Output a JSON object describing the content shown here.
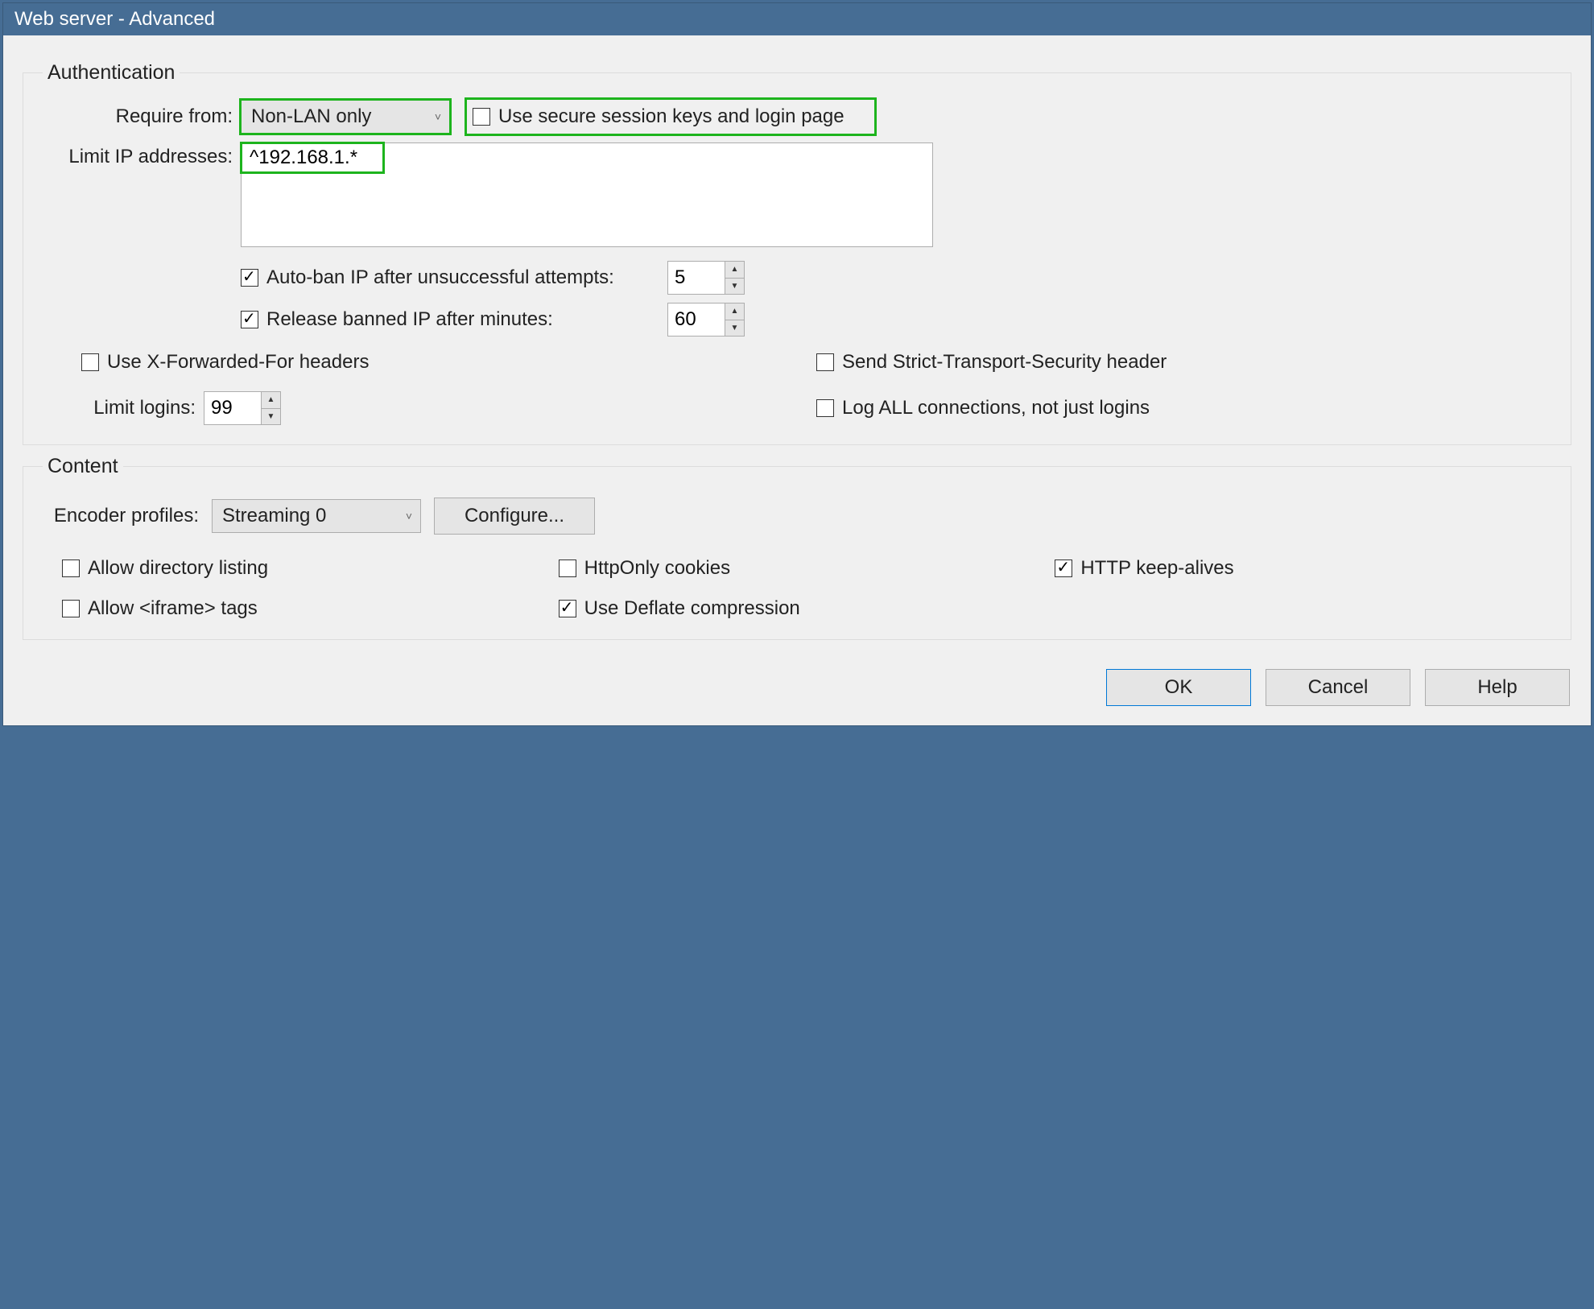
{
  "window": {
    "title": "Web server - Advanced"
  },
  "auth": {
    "legend": "Authentication",
    "require_from_label": "Require from:",
    "require_from_value": "Non-LAN only",
    "secure_session_label": "Use secure session keys and login page",
    "secure_session_checked": false,
    "limit_ip_label": "Limit IP addresses:",
    "limit_ip_value": "^192.168.1.*",
    "autoban_label": "Auto-ban IP after unsuccessful attempts:",
    "autoban_checked": true,
    "autoban_value": "5",
    "release_label": "Release banned IP after minutes:",
    "release_checked": true,
    "release_value": "60",
    "xff_label": "Use X-Forwarded-For headers",
    "xff_checked": false,
    "hsts_label": "Send Strict-Transport-Security header",
    "hsts_checked": false,
    "limit_logins_label": "Limit logins:",
    "limit_logins_value": "99",
    "logall_label": "Log ALL connections, not just logins",
    "logall_checked": false
  },
  "content": {
    "legend": "Content",
    "encoder_label": "Encoder profiles:",
    "encoder_value": "Streaming 0",
    "configure_label": "Configure...",
    "dirlist_label": "Allow directory listing",
    "dirlist_checked": false,
    "httponly_label": "HttpOnly cookies",
    "httponly_checked": false,
    "keepalive_label": "HTTP keep-alives",
    "keepalive_checked": true,
    "iframe_label": "Allow <iframe> tags",
    "iframe_checked": false,
    "deflate_label": "Use Deflate compression",
    "deflate_checked": true
  },
  "buttons": {
    "ok": "OK",
    "cancel": "Cancel",
    "help": "Help"
  }
}
